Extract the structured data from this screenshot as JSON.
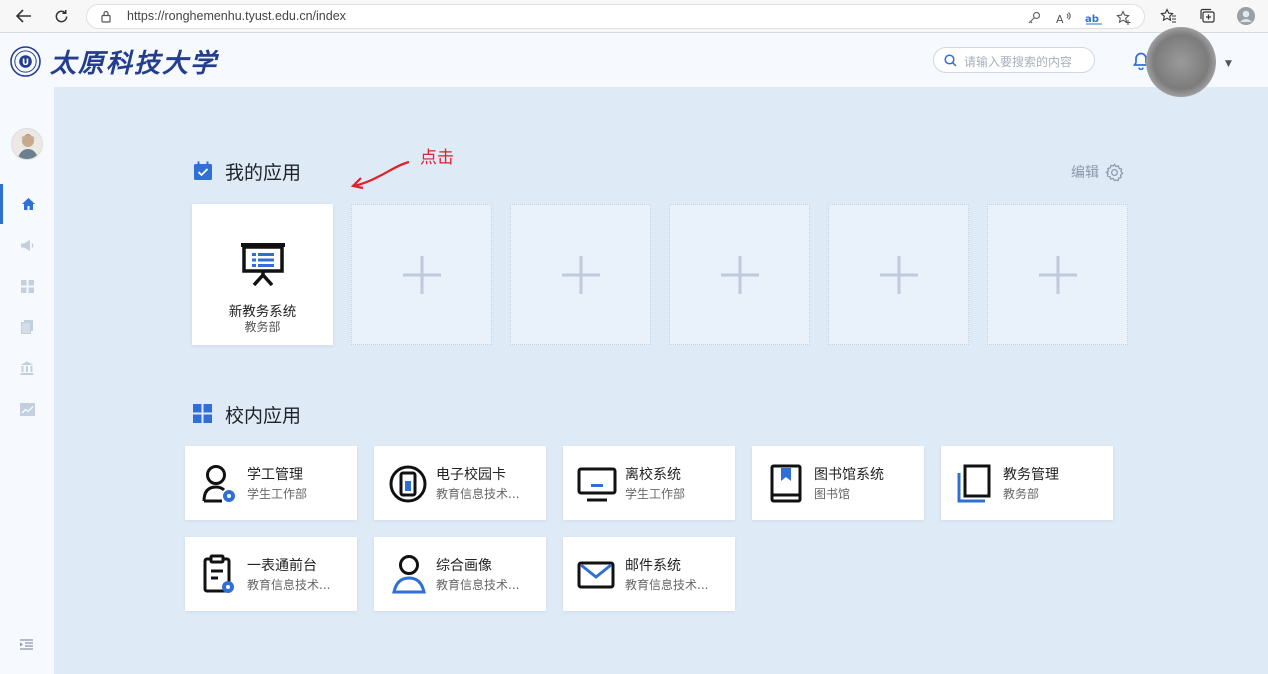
{
  "browser": {
    "url": "https://ronghemenhu.tyust.edu.cn/index"
  },
  "header": {
    "logo_text": "太原科技大学",
    "search_placeholder": "请输入要搜索的内容"
  },
  "annotation": {
    "text": "点击"
  },
  "my_apps": {
    "title": "我的应用",
    "edit_label": "编辑",
    "apps": [
      {
        "name": "新教务系统",
        "dept": "教务部",
        "icon": "presentation-board-icon"
      }
    ],
    "empty_slots": 5
  },
  "campus_apps": {
    "title": "校内应用",
    "items": [
      {
        "title": "学工管理",
        "sub": "学生工作部",
        "icon": "student-affairs-icon"
      },
      {
        "title": "电子校园卡",
        "sub": "教育信息技术...",
        "icon": "campus-card-icon"
      },
      {
        "title": "离校系统",
        "sub": "学生工作部",
        "icon": "monitor-icon"
      },
      {
        "title": "图书馆系统",
        "sub": "图书馆",
        "icon": "book-icon"
      },
      {
        "title": "教务管理",
        "sub": "教务部",
        "icon": "notebook-icon"
      },
      {
        "title": "一表通前台",
        "sub": "教育信息技术...",
        "icon": "clipboard-icon"
      },
      {
        "title": "综合画像",
        "sub": "教育信息技术...",
        "icon": "user-profile-icon"
      },
      {
        "title": "邮件系统",
        "sub": "教育信息技术...",
        "icon": "mail-icon"
      }
    ]
  },
  "colors": {
    "accent": "#2f6fd6",
    "background": "#dfeaf7",
    "annotation": "#e0202a"
  }
}
